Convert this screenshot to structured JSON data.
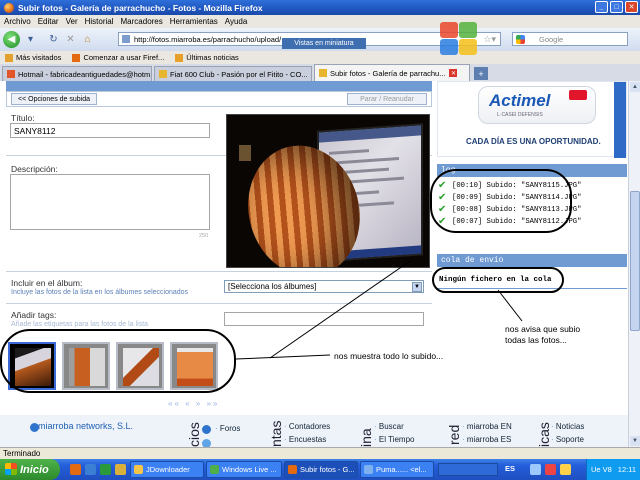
{
  "window": {
    "title": "Subir fotos - Galería de parrachucho - Fotos - Mozilla Firefox"
  },
  "menu": [
    "Archivo",
    "Editar",
    "Ver",
    "Historial",
    "Marcadores",
    "Herramientas",
    "Ayuda"
  ],
  "nav": {
    "url": "http://fotos.miarroba.es/parrachucho/upload/",
    "search_placeholder": "Google",
    "tooltip": "Vistas en miniatura"
  },
  "bookmarks": [
    "Más visitados",
    "Comenzar a usar Firef...",
    "Últimas noticias"
  ],
  "tabs": [
    {
      "label": "Hotmail - fabricadeantiguedades@hotm...",
      "active": false
    },
    {
      "label": "Fiat 600 Club - Pasión por el Fitito - CO...",
      "active": false
    },
    {
      "label": "Subir fotos - Galería de parrachu...",
      "active": true
    }
  ],
  "upload": {
    "options_button": "<< Opciones de subida",
    "pause_button": "Parar / Reanudar",
    "title_label": "Título:",
    "title_value": "SANY8112",
    "description_label": "Descripción:",
    "char_counter": "250",
    "album_label": "Incluir en el álbum:",
    "album_hint": "Incluye las fotos de la lista en los álbumes seleccionados",
    "album_select": "[Selecciona los álbumes]",
    "tags_label": "Añadir tags:",
    "tags_hint": "Añade las etiquetas para las fotos de la lista",
    "pager": "«« «     » »»"
  },
  "ad": {
    "brand": "Actimel",
    "subbrand": "L·CASEI DEFENSIS",
    "slogan": "CADA DÍA ES UNA OPORTUNIDAD."
  },
  "log": {
    "header": "log",
    "lines": [
      "[00:10] Subido: \"SANY8115.JPG\"",
      "[00:09] Subido: \"SANY8114.JPG\"",
      "[00:08] Subido: \"SANY8113.JPG\"",
      "[00:07] Subido: \"SANY8112.JPG\""
    ]
  },
  "queue": {
    "header": "cola de envío",
    "empty_text": "Ningún fichero en la cola"
  },
  "annotations": {
    "uploaded_note": "nos muestra todo lo subido...",
    "notice_note_1": "nos avisa que subio",
    "notice_note_2": "todas las fotos..."
  },
  "footer": {
    "brand": "miarroba networks, S.L.",
    "col1_title": "cios",
    "col1_links": [
      "Foros",
      ""
    ],
    "col2_title": "ntas",
    "col2_links": [
      "Contadores",
      "Encuestas"
    ],
    "col3_title": "ina",
    "col3_links": [
      "Buscar",
      "El Tiempo"
    ],
    "col4_title": "red",
    "col4_links": [
      "miarroba EN",
      "miarroba ES"
    ],
    "col5_title": "icas",
    "col5_links": [
      "Noticias",
      "Soporte"
    ]
  },
  "status": "Terminado",
  "taskbar": {
    "start": "Inicio",
    "buttons": [
      {
        "label": "JDownloader",
        "active": false
      },
      {
        "label": "Windows Live ...",
        "active": false
      },
      {
        "label": "Subir fotos - G...",
        "active": true
      },
      {
        "label": "Puma...... <el...",
        "active": false
      }
    ],
    "lang": "ES",
    "tray_text": "Ue V8",
    "clock": "12:11"
  },
  "colors": {
    "accent_blue": "#6f9ad2",
    "check_green": "#2aa02a",
    "xp_taskbar": "#245edb"
  }
}
